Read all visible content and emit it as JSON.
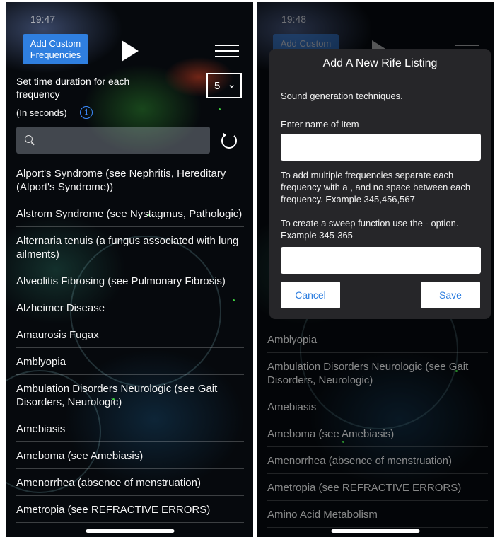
{
  "left": {
    "status_time": "19:47",
    "add_button": "Add Custom Frequencies",
    "duration_label": "Set time duration for each frequency",
    "duration_value": "5",
    "seconds_label": "(In seconds)",
    "info_icon": "i",
    "list": [
      "Alport's Syndrome (see Nephritis, Hereditary (Alport's Syndrome))",
      "Alstrom Syndrome (see Nystagmus, Pathologic)",
      "Alternaria tenuis (a fungus associated with lung ailments)",
      "Alveolitis Fibrosing (see Pulmonary Fibrosis)",
      "Alzheimer Disease",
      "Amaurosis Fugax",
      "Amblyopia",
      "Ambulation Disorders Neurologic (see Gait Disorders, Neurologic)",
      "Amebiasis",
      "Ameboma (see Amebiasis)",
      "Amenorrhea (absence of menstruation)",
      "Ametropia (see REFRACTIVE ERRORS)"
    ]
  },
  "right": {
    "status_time": "19:48",
    "add_button": "Add Custom",
    "modal": {
      "title": "Add A New Rife Listing",
      "subtitle": "Sound generation techniques.",
      "name_label": "Enter name of Item",
      "multi_help": "To add multiple frequencies separate each frequency with a , and no space between each frequency. Example 345,456,567",
      "sweep_help": "To create a sweep function use the - option. Example 345-365",
      "cancel": "Cancel",
      "save": "Save"
    },
    "list": [
      "Amblyopia",
      "Ambulation Disorders Neurologic (see Gait Disorders, Neurologic)",
      "Amebiasis",
      "Ameboma (see Amebiasis)",
      "Amenorrhea (absence of menstruation)",
      "Ametropia (see REFRACTIVE ERRORS)",
      "Amino Acid Metabolism"
    ]
  }
}
